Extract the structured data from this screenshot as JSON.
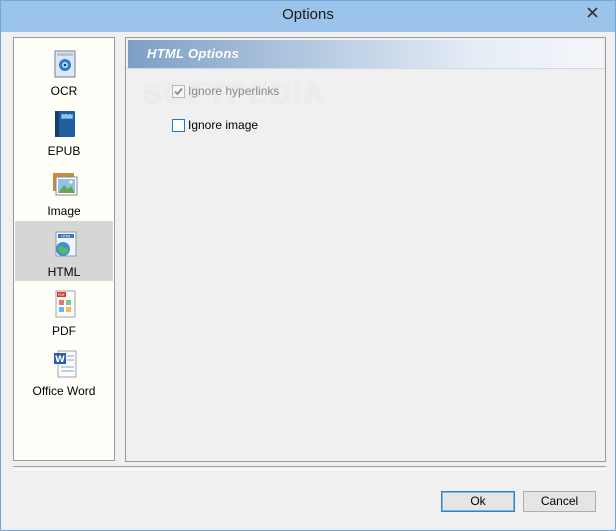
{
  "window": {
    "title": "Options"
  },
  "sidebar": {
    "items": [
      {
        "label": "OCR",
        "icon": "ocr-icon"
      },
      {
        "label": "EPUB",
        "icon": "epub-icon"
      },
      {
        "label": "Image",
        "icon": "image-icon"
      },
      {
        "label": "HTML",
        "icon": "html-icon",
        "selected": true
      },
      {
        "label": "PDF",
        "icon": "pdf-icon"
      },
      {
        "label": "Office Word",
        "icon": "word-icon"
      }
    ]
  },
  "panel": {
    "title": "HTML Options",
    "watermark": "SOFTPEDIA",
    "options": [
      {
        "label": "Ignore hyperlinks",
        "checked": true,
        "enabled": false
      },
      {
        "label": "Ignore image",
        "checked": false,
        "enabled": true
      }
    ]
  },
  "buttons": {
    "ok": "Ok",
    "cancel": "Cancel"
  },
  "colors": {
    "titlebar": "#9cc3ea",
    "selection": "#d6d6d6",
    "header_gradient_start": "#7e9fc5",
    "accent": "#1c7ad4"
  }
}
